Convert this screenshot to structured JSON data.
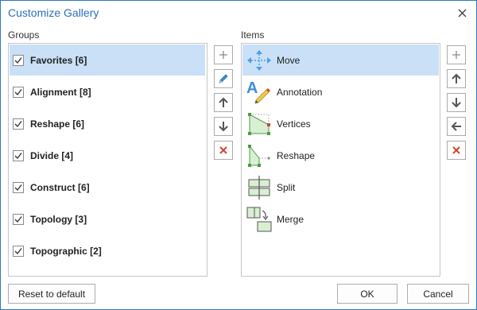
{
  "dialog": {
    "title": "Customize Gallery"
  },
  "groups": {
    "label": "Groups",
    "items": [
      {
        "label": "Favorites [6]",
        "checked": true,
        "selected": true
      },
      {
        "label": "Alignment [8]",
        "checked": true,
        "selected": false
      },
      {
        "label": "Reshape [6]",
        "checked": true,
        "selected": false
      },
      {
        "label": "Divide [4]",
        "checked": true,
        "selected": false
      },
      {
        "label": "Construct [6]",
        "checked": true,
        "selected": false
      },
      {
        "label": "Topology [3]",
        "checked": true,
        "selected": false
      },
      {
        "label": "Topographic [2]",
        "checked": true,
        "selected": false
      }
    ]
  },
  "items": {
    "label": "Items",
    "list": [
      {
        "label": "Move",
        "icon": "move-icon",
        "selected": true
      },
      {
        "label": "Annotation",
        "icon": "annotation-icon",
        "selected": false
      },
      {
        "label": "Vertices",
        "icon": "vertices-icon",
        "selected": false
      },
      {
        "label": "Reshape",
        "icon": "reshape-icon",
        "selected": false
      },
      {
        "label": "Split",
        "icon": "split-icon",
        "selected": false
      },
      {
        "label": "Merge",
        "icon": "merge-icon",
        "selected": false
      }
    ]
  },
  "group_tools": [
    "add-icon",
    "edit-icon",
    "arrow-up-icon",
    "arrow-down-icon",
    "delete-icon"
  ],
  "item_tools": [
    "add-icon",
    "arrow-up-icon",
    "arrow-down-icon",
    "arrow-left-icon",
    "delete-icon"
  ],
  "footer": {
    "reset_label": "Reset to default",
    "ok_label": "OK",
    "cancel_label": "Cancel"
  },
  "colors": {
    "accent": "#2a6fbb",
    "selection": "#c9e0f7",
    "delete": "#d0452e",
    "icon_blue": "#4a9fe0",
    "icon_gray": "#555555"
  }
}
